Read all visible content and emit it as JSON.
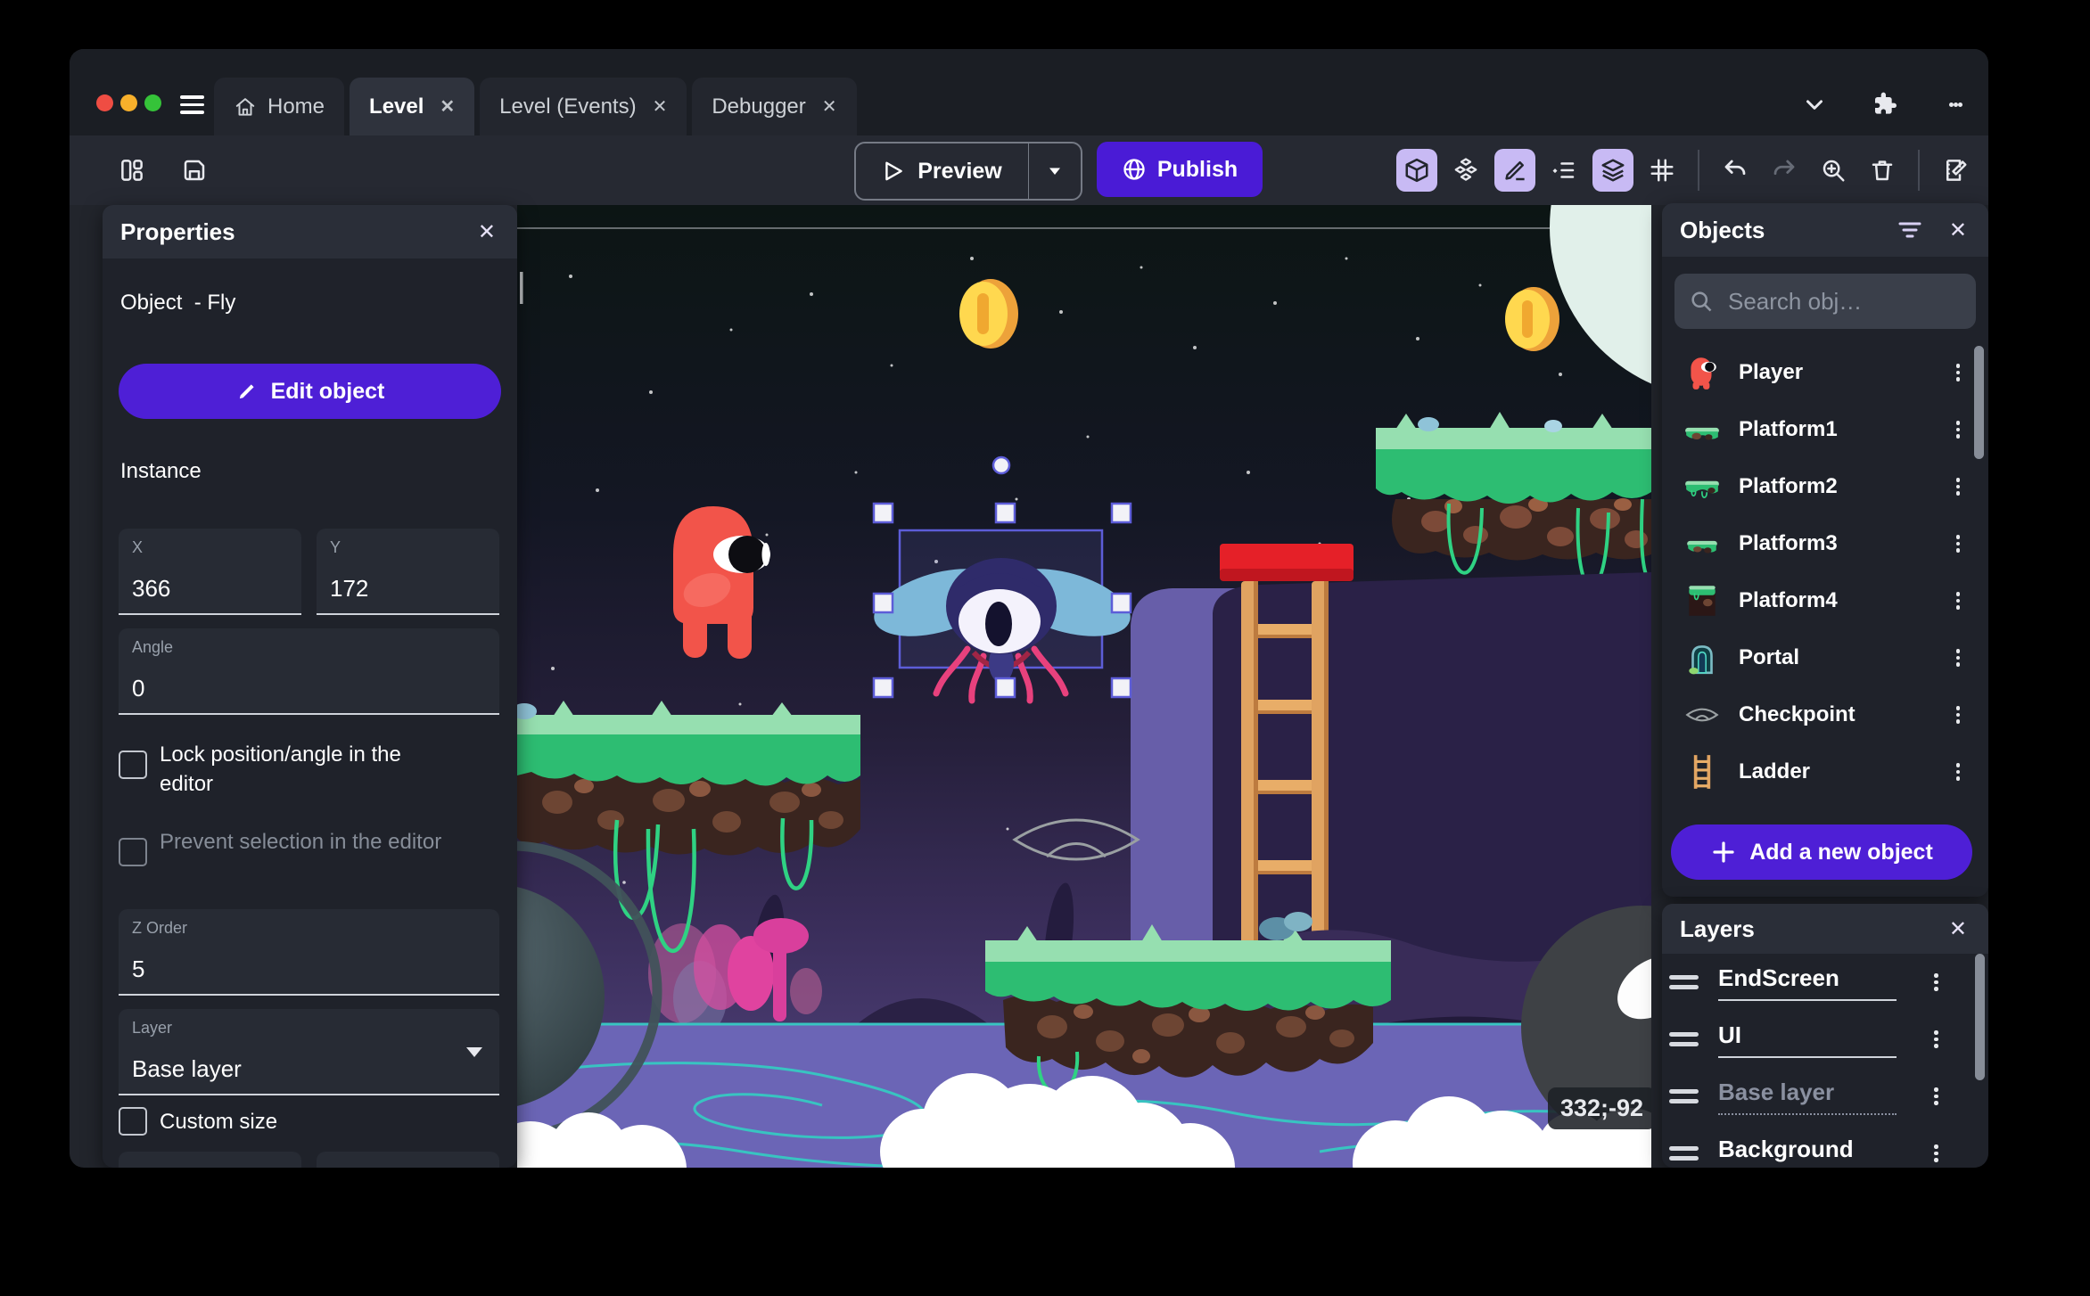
{
  "theme": {
    "accent_purple": "#4e1fd6",
    "active_icon_bg": "#c8baf4",
    "selection_blue": "#5d5dd8"
  },
  "titlebar": {
    "tabs": [
      {
        "label": "Home"
      },
      {
        "label": "Level",
        "active": true
      },
      {
        "label": "Level (Events)"
      },
      {
        "label": "Debugger"
      }
    ]
  },
  "toolbar": {
    "preview_label": "Preview",
    "publish_label": "Publish"
  },
  "properties_panel": {
    "title": "Properties",
    "object_heading": "Object  - Fly",
    "edit_button": "Edit object",
    "instance_heading": "Instance",
    "fields": {
      "x": {
        "label": "X",
        "value": "366"
      },
      "y": {
        "label": "Y",
        "value": "172"
      },
      "angle": {
        "label": "Angle",
        "value": "0"
      },
      "z_order": {
        "label": "Z Order",
        "value": "5"
      },
      "layer": {
        "label": "Layer",
        "value": "Base layer"
      }
    },
    "checkboxes": {
      "lock": "Lock position/angle in the editor",
      "prevent": "Prevent selection in the editor",
      "custom_size": "Custom size"
    }
  },
  "scene": {
    "coordinate_badge": "332;-92"
  },
  "objects_panel": {
    "title": "Objects",
    "search_placeholder": "Search obj…",
    "items": [
      {
        "label": "Player"
      },
      {
        "label": "Platform1"
      },
      {
        "label": "Platform2"
      },
      {
        "label": "Platform3"
      },
      {
        "label": "Platform4"
      },
      {
        "label": "Portal"
      },
      {
        "label": "Checkpoint"
      },
      {
        "label": "Ladder"
      }
    ],
    "add_button": "Add a new object"
  },
  "layers_panel": {
    "title": "Layers",
    "layers": [
      {
        "name": "EndScreen"
      },
      {
        "name": "UI"
      },
      {
        "name": "Base layer",
        "dimmed": true
      },
      {
        "name": "Background"
      }
    ]
  }
}
